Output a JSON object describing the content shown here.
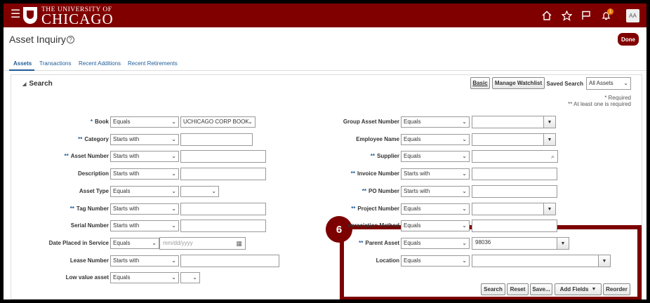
{
  "header": {
    "university_line1": "THE UNIVERSITY OF",
    "university_line2": "CHICAGO",
    "notification_count": "1",
    "avatar_initials": "AA"
  },
  "page": {
    "title": "Asset Inquiry",
    "help_glyph": "?",
    "done_label": "Done"
  },
  "tabs": [
    {
      "label": "Assets"
    },
    {
      "label": "Transactions"
    },
    {
      "label": "Recent Additions"
    },
    {
      "label": "Recent Retirements"
    }
  ],
  "search": {
    "header": "Search",
    "basic_label": "Basic",
    "manage_watchlist_label": "Manage Watchlist",
    "saved_search_label": "Saved Search",
    "saved_search_value": "All Assets",
    "required_note": "* Required",
    "at_least_one_note": "** At least one is required"
  },
  "left_fields": [
    {
      "star": "*",
      "label": "Book",
      "operator": "Equals",
      "value": "UCHICAGO CORP BOOK"
    },
    {
      "star": "**",
      "label": "Category",
      "operator": "Starts with",
      "value": ""
    },
    {
      "star": "**",
      "label": "Asset Number",
      "operator": "Starts with",
      "value": ""
    },
    {
      "star": "",
      "label": "Description",
      "operator": "Starts with",
      "value": ""
    },
    {
      "star": "",
      "label": "Asset Type",
      "operator": "Equals",
      "value": ""
    },
    {
      "star": "**",
      "label": "Tag Number",
      "operator": "Starts with",
      "value": ""
    },
    {
      "star": "",
      "label": "Serial Number",
      "operator": "Starts with",
      "value": ""
    },
    {
      "star": "",
      "label": "Date Placed in Service",
      "operator": "Equals",
      "value": "",
      "placeholder": "mm/dd/yyyy"
    },
    {
      "star": "",
      "label": "Lease Number",
      "operator": "Starts with",
      "value": ""
    },
    {
      "star": "",
      "label": "Low value asset",
      "operator": "Equals",
      "value": ""
    }
  ],
  "right_fields": [
    {
      "star": "",
      "label": "Group Asset Number",
      "operator": "Equals",
      "value": ""
    },
    {
      "star": "",
      "label": "Employee Name",
      "operator": "Equals",
      "value": ""
    },
    {
      "star": "**",
      "label": "Supplier",
      "operator": "Equals",
      "value": ""
    },
    {
      "star": "**",
      "label": "Invoice Number",
      "operator": "Starts with",
      "value": ""
    },
    {
      "star": "**",
      "label": "PO Number",
      "operator": "Starts with",
      "value": ""
    },
    {
      "star": "**",
      "label": "Project Number",
      "operator": "Equals",
      "value": ""
    },
    {
      "star": "",
      "label": "epreciation Method",
      "operator": "Equals",
      "value": ""
    },
    {
      "star": "**",
      "label": "Parent Asset",
      "operator": "Equals",
      "value": "98036"
    },
    {
      "star": "",
      "label": "Location",
      "operator": "Equals",
      "value": ""
    }
  ],
  "actions": {
    "search": "Search",
    "reset": "Reset",
    "save": "Save...",
    "add_fields": "Add Fields",
    "reorder": "Reorder"
  },
  "callout": {
    "number": "6",
    "color": "#7d0000"
  }
}
